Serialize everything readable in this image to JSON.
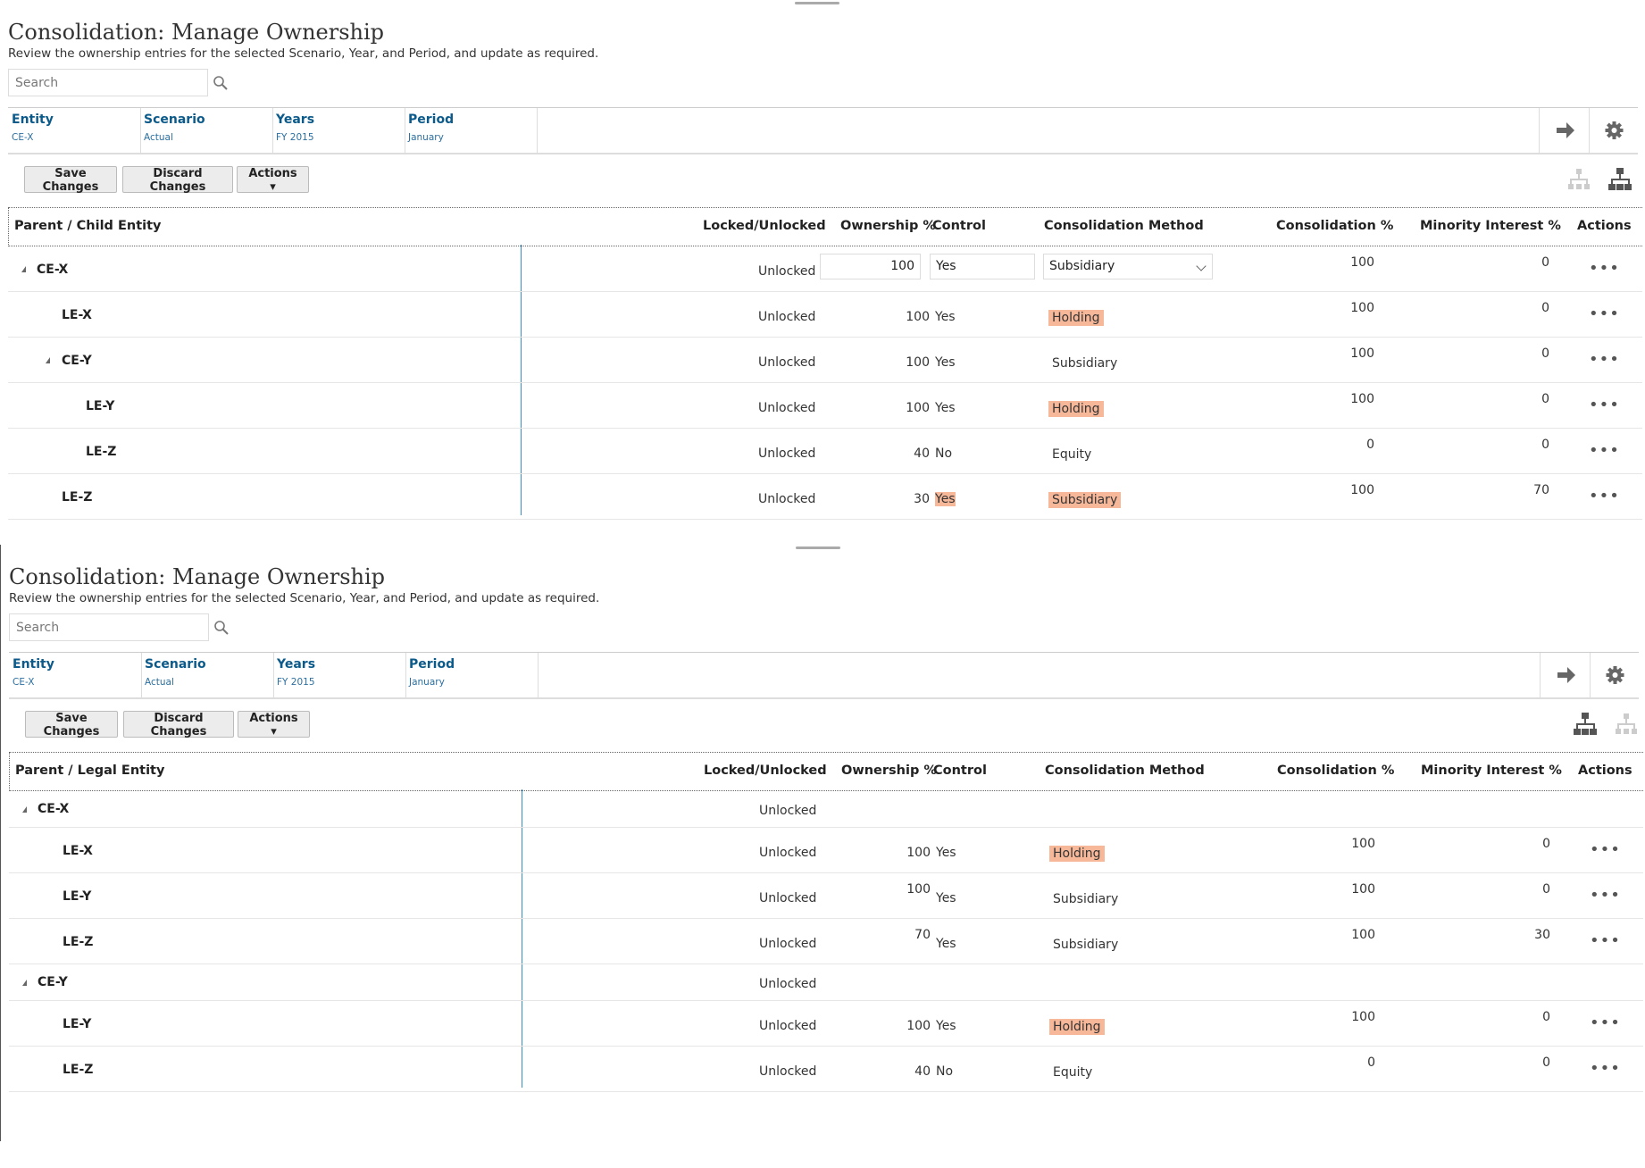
{
  "panels": [
    {
      "title": "Consolidation: Manage Ownership",
      "subtitle": "Review the ownership entries for the selected Scenario, Year, and Period, and update as required.",
      "search_placeholder": "Search",
      "pov": [
        {
          "label": "Entity",
          "value": "CE-X"
        },
        {
          "label": "Scenario",
          "value": "Actual"
        },
        {
          "label": "Years",
          "value": "FY 2015"
        },
        {
          "label": "Period",
          "value": "January"
        }
      ],
      "buttons": {
        "save": "Save Changes",
        "discard": "Discard Changes",
        "actions": "Actions"
      },
      "columns": {
        "entity": "Parent / Child Entity",
        "locked": "Locked/Unlocked",
        "ownership": "Ownership %",
        "control": "Control",
        "method": "Consolidation Method",
        "consolidation": "Consolidation %",
        "minority": "Minority Interest %",
        "actions": "Actions"
      }
    },
    {
      "title": "Consolidation: Manage Ownership",
      "subtitle": "Review the ownership entries for the selected Scenario, Year, and Period, and update as required.",
      "search_placeholder": "Search",
      "pov": [
        {
          "label": "Entity",
          "value": "CE-X"
        },
        {
          "label": "Scenario",
          "value": "Actual"
        },
        {
          "label": "Years",
          "value": "FY 2015"
        },
        {
          "label": "Period",
          "value": "January"
        }
      ],
      "buttons": {
        "save": "Save Changes",
        "discard": "Discard Changes",
        "actions": "Actions"
      },
      "columns": {
        "entity": "Parent / Legal Entity",
        "locked": "Locked/Unlocked",
        "ownership": "Ownership %",
        "control": "Control",
        "method": "Consolidation Method",
        "consolidation": "Consolidation %",
        "minority": "Minority Interest %",
        "actions": "Actions"
      }
    }
  ],
  "rows1": [
    {
      "name": "CE-X",
      "expanded": true,
      "locked": "Unlocked",
      "own": "100",
      "ctrl": "Yes",
      "cm": "Subsidiary",
      "cons": "100",
      "mi": "0",
      "editing": true
    },
    {
      "name": "LE-X",
      "locked": "Unlocked",
      "own": "100",
      "ctrl": "Yes",
      "cm": "Holding",
      "cons": "100",
      "mi": "0",
      "cm_hl": true
    },
    {
      "name": "CE-Y",
      "expanded": true,
      "locked": "Unlocked",
      "own": "100",
      "ctrl": "Yes",
      "cm": "Subsidiary",
      "cons": "100",
      "mi": "0"
    },
    {
      "name": "LE-Y",
      "locked": "Unlocked",
      "own": "100",
      "ctrl": "Yes",
      "cm": "Holding",
      "cons": "100",
      "mi": "0",
      "cm_hl": true
    },
    {
      "name": "LE-Z",
      "locked": "Unlocked",
      "own": "40",
      "ctrl": "No",
      "cm": "Equity",
      "cons": "0",
      "mi": "0"
    },
    {
      "name": "LE-Z",
      "locked": "Unlocked",
      "own": "30",
      "ctrl": "Yes",
      "cm": "Subsidiary",
      "cons": "100",
      "mi": "70",
      "ctrl_hl": true,
      "cm_hl": true
    }
  ],
  "rows2": [
    {
      "name": "CE-X",
      "expanded": true,
      "locked": "Unlocked"
    },
    {
      "name": "LE-X",
      "locked": "Unlocked",
      "own": "100",
      "ctrl": "Yes",
      "cm": "Holding",
      "cons": "100",
      "mi": "0",
      "cm_hl": true
    },
    {
      "name": "LE-Y",
      "locked": "Unlocked",
      "own": "100",
      "ctrl": "Yes",
      "cm": "Subsidiary",
      "cons": "100",
      "mi": "0"
    },
    {
      "name": "LE-Z",
      "locked": "Unlocked",
      "own": "70",
      "ctrl": "Yes",
      "cm": "Subsidiary",
      "cons": "100",
      "mi": "30"
    },
    {
      "name": "CE-Y",
      "expanded": true,
      "locked": "Unlocked"
    },
    {
      "name": "LE-Y",
      "locked": "Unlocked",
      "own": "100",
      "ctrl": "Yes",
      "cm": "Holding",
      "cons": "100",
      "mi": "0",
      "cm_hl": true
    },
    {
      "name": "LE-Z",
      "locked": "Unlocked",
      "own": "40",
      "ctrl": "No",
      "cm": "Equity",
      "cons": "0",
      "mi": "0"
    }
  ],
  "icons": {
    "search": "search-icon",
    "pov_go": "arrow-right-icon",
    "pov_settings": "gear-icon",
    "tree_a": "hierarchy-icon",
    "tree_b": "hierarchy-icon",
    "row_actions": "more-horizontal-icon"
  },
  "colors": {
    "highlight": "#f7b89a",
    "link": "#0b5a8a",
    "tree_line": "#3a8fc8"
  }
}
